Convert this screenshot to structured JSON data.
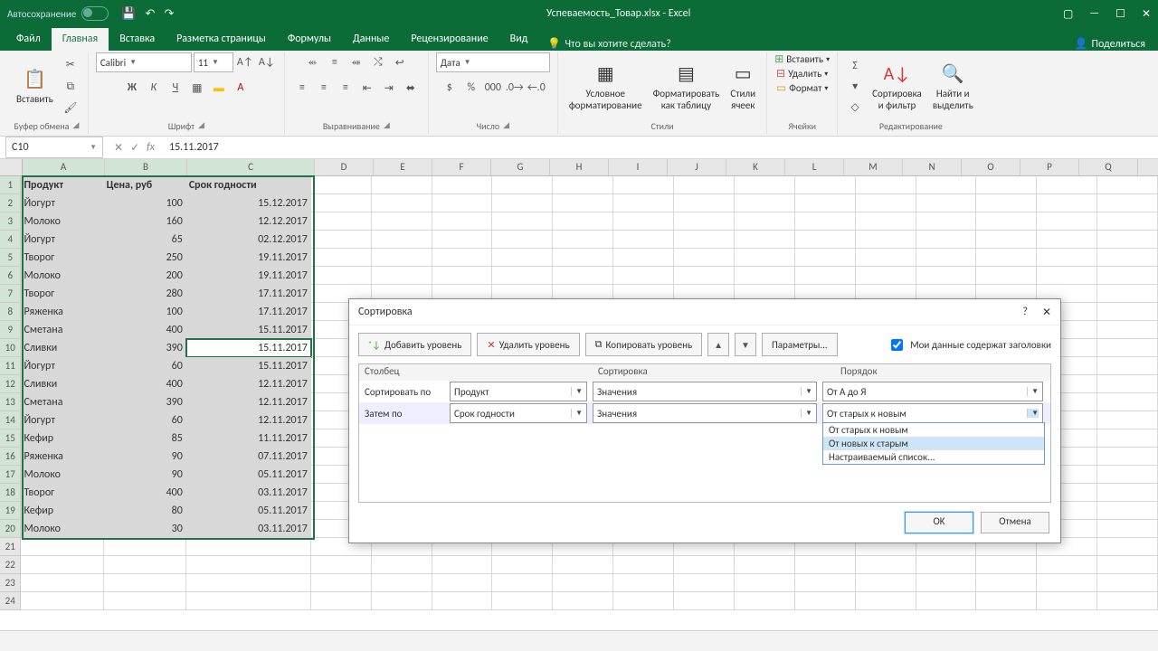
{
  "title": {
    "autosave": "Автосохранение",
    "doc": "Успеваемость_Товар.xlsx - Excel"
  },
  "tabs": [
    "Файл",
    "Главная",
    "Вставка",
    "Разметка страницы",
    "Формулы",
    "Данные",
    "Рецензирование",
    "Вид"
  ],
  "tell": "Что вы хотите сделать?",
  "share": "Поделиться",
  "ribbon": {
    "clipboard": {
      "paste": "Вставить",
      "label": "Буфер обмена"
    },
    "font": {
      "name": "Calibri",
      "size": "11",
      "label": "Шрифт"
    },
    "align": {
      "label": "Выравнивание"
    },
    "number": {
      "fmt": "Дата",
      "label": "Число"
    },
    "styles": {
      "cond": "Условное\nформатирование",
      "table": "Форматировать\nкак таблицу",
      "cell": "Стили\nячеек",
      "label": "Стили"
    },
    "cells": {
      "insert": "Вставить",
      "delete": "Удалить",
      "format": "Формат",
      "label": "Ячейки"
    },
    "edit": {
      "sort": "Сортировка\nи фильтр",
      "find": "Найти и\nвыделить",
      "label": "Редактирование"
    }
  },
  "namebox": "C10",
  "formula": "15.11.2017",
  "columns": [
    "A",
    "B",
    "C",
    "D",
    "E",
    "F",
    "G",
    "H",
    "I",
    "J",
    "K",
    "L",
    "M",
    "N",
    "O",
    "P",
    "Q"
  ],
  "headers": [
    "Продукт",
    "Цена, руб",
    "Срок годности"
  ],
  "data": [
    [
      "Йогурт",
      "100",
      "15.12.2017"
    ],
    [
      "Молоко",
      "160",
      "12.12.2017"
    ],
    [
      "Йогурт",
      "65",
      "02.12.2017"
    ],
    [
      "Творог",
      "250",
      "19.11.2017"
    ],
    [
      "Молоко",
      "200",
      "19.11.2017"
    ],
    [
      "Творог",
      "280",
      "17.11.2017"
    ],
    [
      "Ряженка",
      "100",
      "17.11.2017"
    ],
    [
      "Сметана",
      "400",
      "15.11.2017"
    ],
    [
      "Сливки",
      "390",
      "15.11.2017"
    ],
    [
      "Йогурт",
      "60",
      "15.11.2017"
    ],
    [
      "Сливки",
      "400",
      "12.11.2017"
    ],
    [
      "Сметана",
      "390",
      "12.11.2017"
    ],
    [
      "Йогурт",
      "60",
      "12.11.2017"
    ],
    [
      "Кефир",
      "85",
      "11.11.2017"
    ],
    [
      "Ряженка",
      "90",
      "07.11.2017"
    ],
    [
      "Молоко",
      "90",
      "05.11.2017"
    ],
    [
      "Творог",
      "400",
      "03.11.2017"
    ],
    [
      "Кефир",
      "80",
      "05.11.2017"
    ],
    [
      "Молоко",
      "30",
      "03.11.2017"
    ]
  ],
  "dialog": {
    "title": "Сортировка",
    "help": "?",
    "add": "Добавить уровень",
    "del": "Удалить уровень",
    "copy": "Копировать уровень",
    "params": "Параметры...",
    "headers_chk": "Мои данные содержат заголовки",
    "col_h": "Столбец",
    "sort_h": "Сортировка",
    "order_h": "Порядок",
    "r1_lbl": "Сортировать по",
    "r1_col": "Продукт",
    "r1_sort": "Значения",
    "r1_ord": "От А до Я",
    "r2_lbl": "Затем по",
    "r2_col": "Срок годности",
    "r2_sort": "Значения",
    "r2_ord": "От старых к новым",
    "ok": "OK",
    "cancel": "Отмена",
    "dropdown": [
      "От старых к новым",
      "От новых к старым",
      "Настраиваемый список..."
    ]
  }
}
